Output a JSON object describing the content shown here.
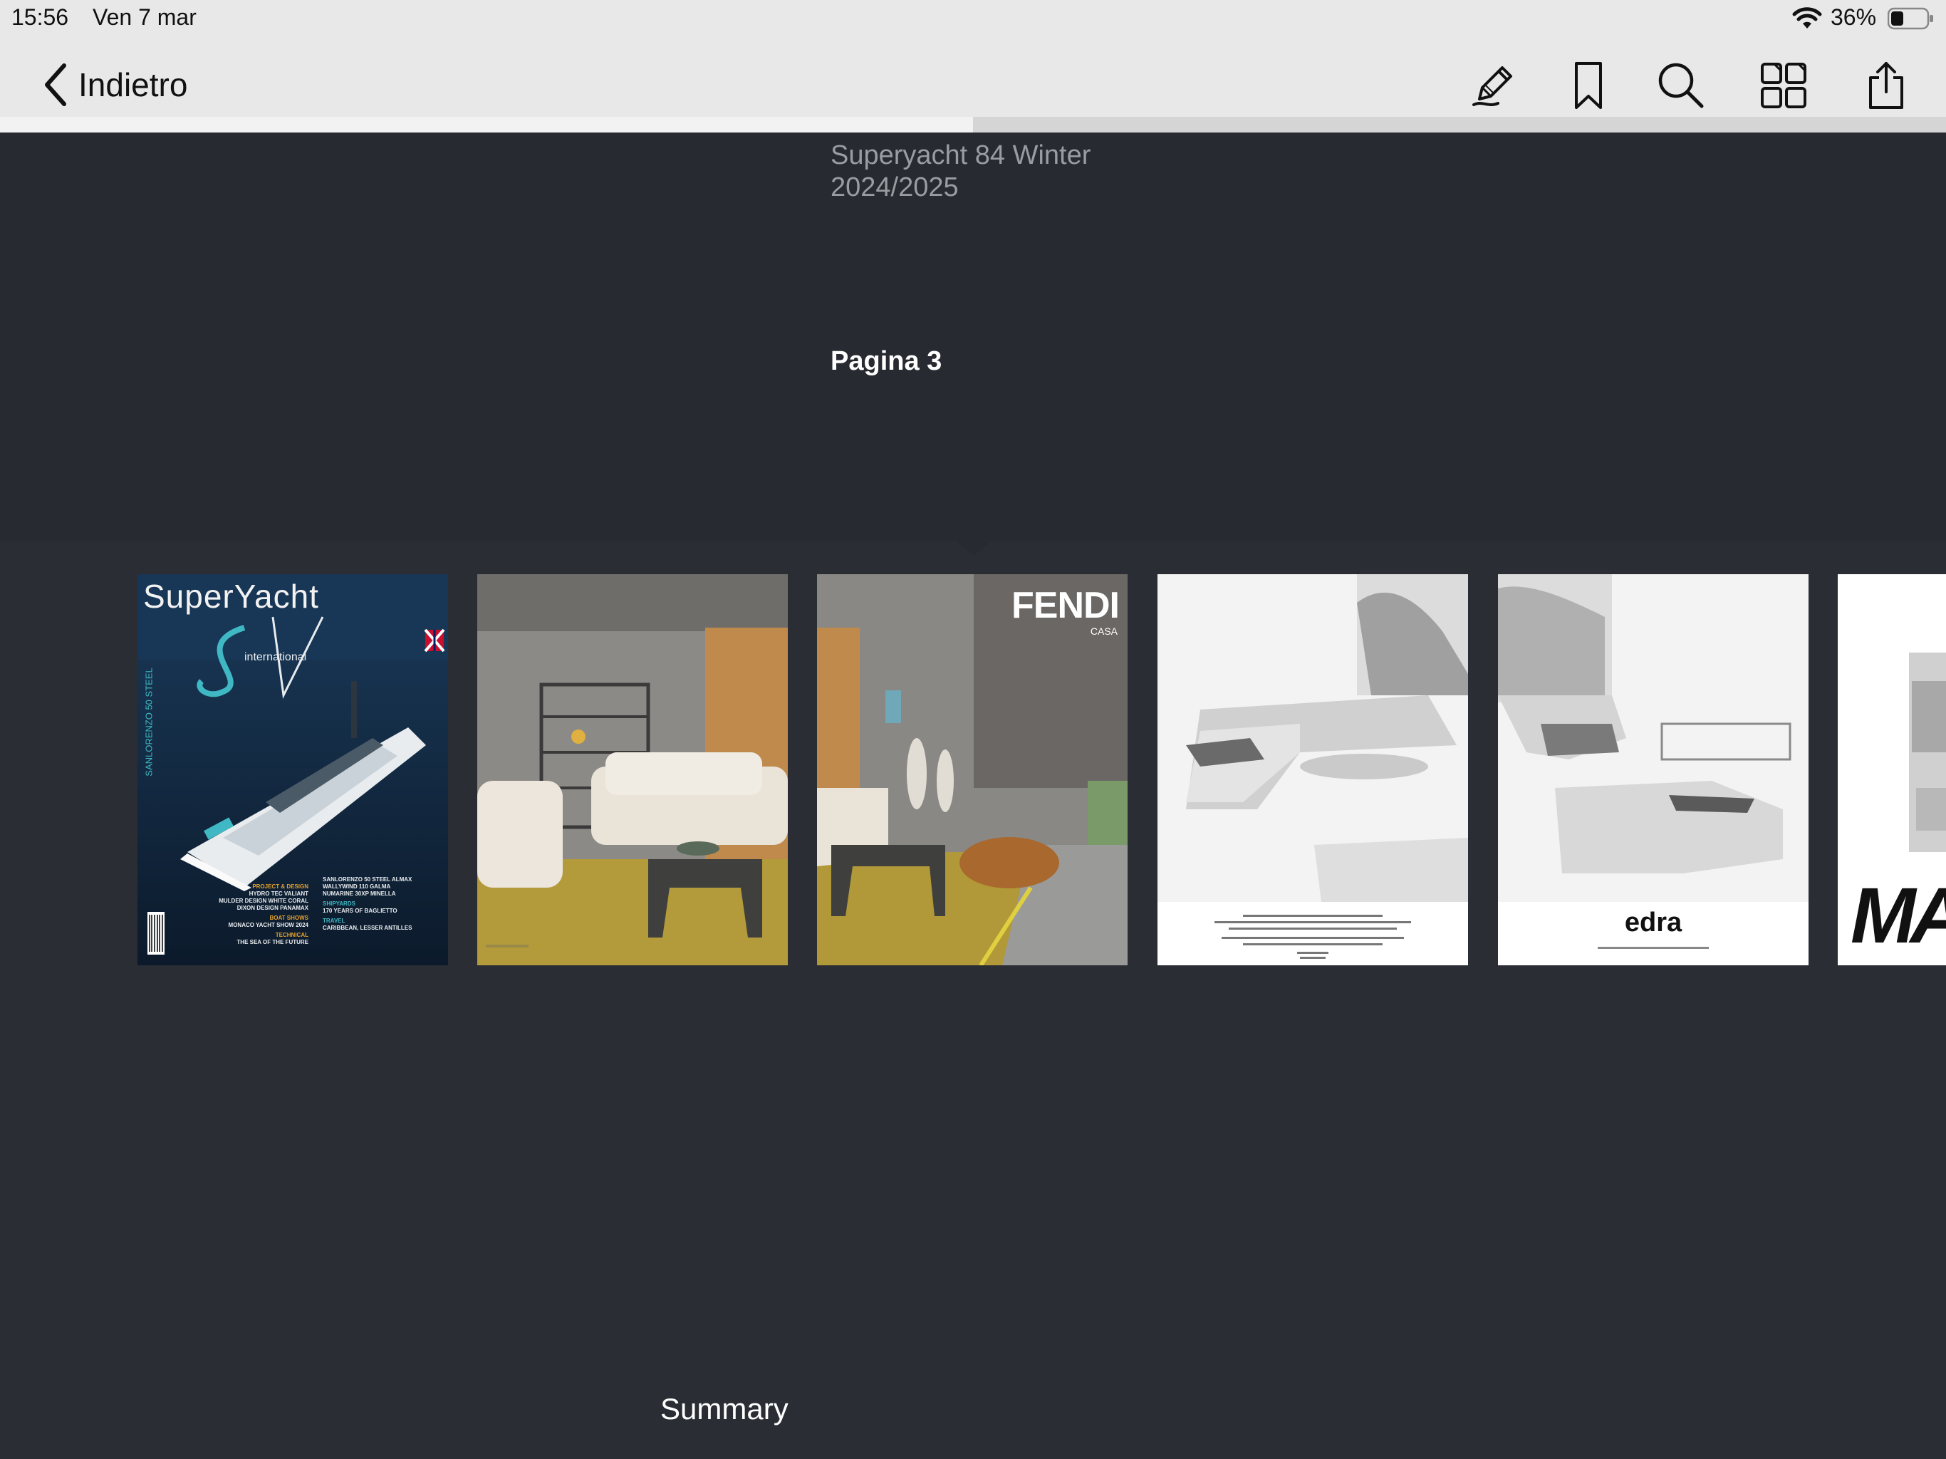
{
  "status": {
    "time": "15:56",
    "date": "Ven 7 mar",
    "battery": "36%",
    "battery_level": 0.36
  },
  "nav": {
    "back_label": "Indietro"
  },
  "toolbar": [
    "annotate-icon",
    "bookmark-icon",
    "search-icon",
    "grid-icon",
    "share-icon"
  ],
  "reading_progress": 0.5,
  "document": {
    "title": "Superyacht 84 Winter 2024/2025",
    "page_label": "Pagina 3"
  },
  "thumbnails": {
    "cover": {
      "masthead": "SuperYacht",
      "subtitle": "international",
      "spine": "SANLORENZO 50 STEEL",
      "lines_left": [
        "PROJECT & DESIGN",
        "HYDRO TEC VALIANT",
        "MULDER DESIGN WHITE CORAL",
        "DIXON DESIGN PANAMAX",
        "BOAT SHOWS",
        "MONACO YACHT SHOW 2024",
        "TECHNICAL",
        "THE SEA OF THE FUTURE"
      ],
      "lines_right": [
        "SANLORENZO 50 STEEL ALMAX",
        "WALLYWIND 110 GALMA",
        "NUMARINE 30XP MINELLA",
        "SHIPYARDS",
        "170 YEARS OF BAGLIETTO",
        "TRAVEL",
        "CARIBBEAN, LESSER ANTILLES"
      ]
    },
    "fendi": {
      "brand": "FENDI",
      "sub": "CASA"
    },
    "edra": {
      "brand": "edra"
    },
    "partial": {
      "brand": "MA"
    }
  },
  "footer": {
    "summary_label": "Summary"
  },
  "colors": {
    "bar": "#e8e8e8",
    "background": "#2a2d33",
    "info_bg": "#272a30"
  }
}
